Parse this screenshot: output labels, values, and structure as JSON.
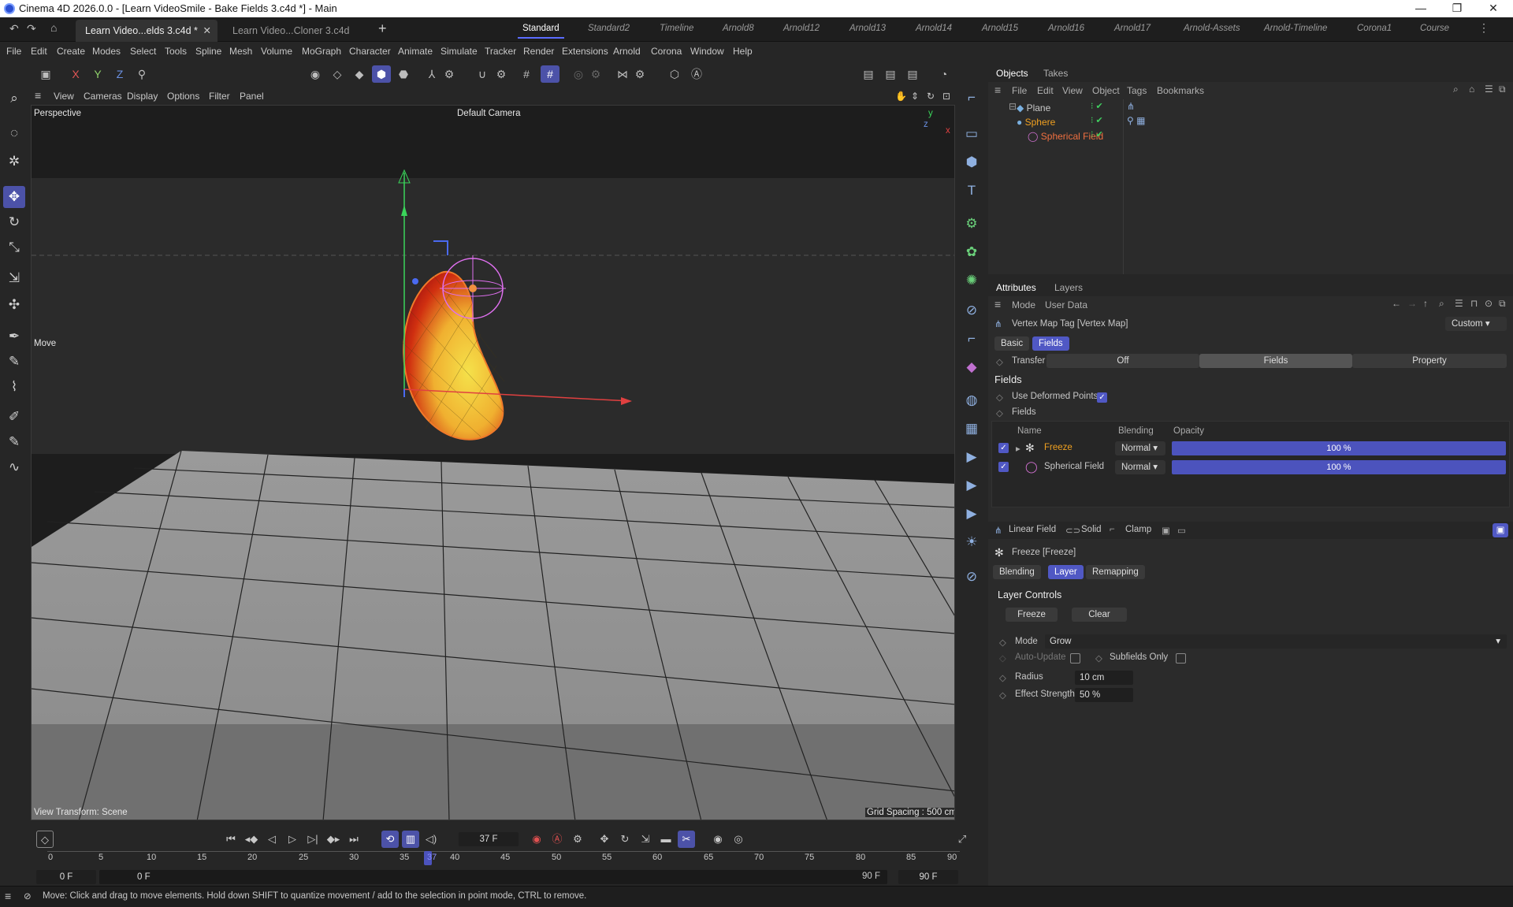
{
  "titlebar": {
    "title": "Cinema 4D 2026.0.0 - [Learn VideoSmile - Bake Fields 3.c4d *] - Main",
    "minimize": "—",
    "maximize": "❐",
    "close": "✕"
  },
  "doc_tabs": [
    {
      "label": "Learn Video...elds 3.c4d *"
    },
    {
      "label": "Learn Video...Cloner 3.c4d"
    }
  ],
  "layout_tabs": [
    "Standard",
    "Standard2",
    "Timeline",
    "Arnold8",
    "Arnold12",
    "Arnold13",
    "Arnold14",
    "Arnold15",
    "Arnold16",
    "Arnold17",
    "Arnold-Assets",
    "Arnold-Timeline",
    "Corona1",
    "Course"
  ],
  "menu": [
    "File",
    "Edit",
    "Create",
    "Modes",
    "Select",
    "Tools",
    "Spline",
    "Mesh",
    "Volume",
    "MoGraph",
    "Character",
    "Animate",
    "Simulate",
    "Tracker",
    "Render",
    "Extensions",
    "Arnold",
    "Corona",
    "Window",
    "Help"
  ],
  "toolbar": {
    "axis_x": "X",
    "axis_y": "Y",
    "axis_z": "Z"
  },
  "viewport": {
    "menu": [
      "View",
      "Cameras",
      "Display",
      "Options",
      "Filter",
      "Panel"
    ],
    "perspective": "Perspective",
    "camera": "Default Camera",
    "tool_label": "Move",
    "view_transform": "View Transform: Scene",
    "grid_spacing": "Grid Spacing : 500 cm",
    "axis_y": "y",
    "axis_z": "z",
    "axis_x": "x"
  },
  "objects": {
    "tabs": [
      "Objects",
      "Takes"
    ],
    "menu": [
      "File",
      "Edit",
      "View",
      "Object",
      "Tags",
      "Bookmarks"
    ],
    "items": [
      {
        "name": "Plane"
      },
      {
        "name": "Sphere"
      },
      {
        "name": "Spherical Field"
      }
    ]
  },
  "attributes": {
    "tabs": [
      "Attributes",
      "Layers"
    ],
    "menu": [
      "Mode",
      "User Data"
    ],
    "header": "Vertex Map Tag [Vertex Map]",
    "preset": "Custom",
    "sub_tabs": [
      "Basic",
      "Fields"
    ],
    "transfer_label": "Transfer",
    "transfer_options": [
      "Off",
      "Fields",
      "Property"
    ],
    "section_title": "Fields",
    "use_deformed": "Use Deformed Points",
    "fields_label": "Fields",
    "columns": [
      "Name",
      "Blending",
      "Opacity"
    ],
    "layers": [
      {
        "name": "Freeze",
        "blending": "Normal",
        "opacity": "100 %",
        "opacity_value": 1.0
      },
      {
        "name": "Spherical Field",
        "blending": "Normal",
        "opacity": "100 %",
        "opacity_value": 1.0
      }
    ],
    "add_buttons": [
      "Linear Field",
      "Solid",
      "Clamp"
    ],
    "layer_header": "Freeze [Freeze]",
    "layer_tabs": [
      "Blending",
      "Layer",
      "Remapping"
    ],
    "layer_controls_title": "Layer Controls",
    "freeze_btn": "Freeze",
    "clear_btn": "Clear",
    "mode_label": "Mode",
    "mode_value": "Grow",
    "auto_update": "Auto-Update",
    "subfields_only": "Subfields Only",
    "radius_label": "Radius",
    "radius_value": "10 cm",
    "effect_label": "Effect Strength",
    "effect_value": "50 %"
  },
  "timeline": {
    "current_frame": "37 F",
    "ticks": [
      "0",
      "5",
      "10",
      "15",
      "20",
      "25",
      "30",
      "35",
      "37",
      "40",
      "45",
      "50",
      "55",
      "60",
      "65",
      "70",
      "75",
      "80",
      "85",
      "90"
    ],
    "start_a": "0 F",
    "start_b": "0 F",
    "end_a": "90 F",
    "end_b": "90 F"
  },
  "status": "Move: Click and drag to move elements. Hold down SHIFT to quantize movement / add to the selection in point mode, CTRL to remove."
}
